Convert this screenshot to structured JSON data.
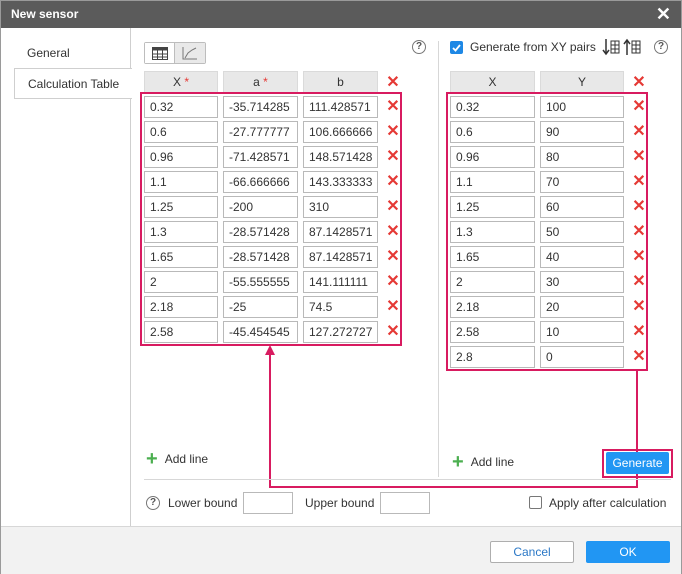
{
  "window": {
    "title": "New sensor"
  },
  "sidebar": {
    "tabs": [
      {
        "label": "General"
      },
      {
        "label": "Calculation Table"
      }
    ]
  },
  "left_table": {
    "headers": [
      "X",
      "a",
      "b"
    ],
    "rows": [
      [
        "0.32",
        "-35.714285",
        "111.428571"
      ],
      [
        "0.6",
        "-27.777777",
        "106.666666"
      ],
      [
        "0.96",
        "-71.428571",
        "148.571428"
      ],
      [
        "1.1",
        "-66.666666",
        "143.333333"
      ],
      [
        "1.25",
        "-200",
        "310"
      ],
      [
        "1.3",
        "-28.571428",
        "87.1428571"
      ],
      [
        "1.65",
        "-28.571428",
        "87.1428571"
      ],
      [
        "2",
        "-55.555555",
        "141.111111"
      ],
      [
        "2.18",
        "-25",
        "74.5"
      ],
      [
        "2.58",
        "-45.454545",
        "127.272727"
      ]
    ],
    "add_line_label": "Add line"
  },
  "right_table": {
    "generate_checkbox_label": "Generate from XY pairs",
    "generate_checked": true,
    "headers": [
      "X",
      "Y"
    ],
    "rows": [
      [
        "0.32",
        "100"
      ],
      [
        "0.6",
        "90"
      ],
      [
        "0.96",
        "80"
      ],
      [
        "1.1",
        "70"
      ],
      [
        "1.25",
        "60"
      ],
      [
        "1.3",
        "50"
      ],
      [
        "1.65",
        "40"
      ],
      [
        "2",
        "30"
      ],
      [
        "2.18",
        "20"
      ],
      [
        "2.58",
        "10"
      ],
      [
        "2.8",
        "0"
      ]
    ],
    "add_line_label": "Add line",
    "generate_button_label": "Generate"
  },
  "bounds": {
    "lower_label": "Lower bound",
    "lower_value": "",
    "upper_label": "Upper bound",
    "upper_value": "",
    "apply_label": "Apply after calculation",
    "apply_checked": false
  },
  "footer": {
    "cancel_label": "Cancel",
    "ok_label": "OK"
  },
  "colors": {
    "accent": "#2196f3",
    "delete": "#e53935",
    "highlight": "#d81b60",
    "add": "#4caf50",
    "titlebar": "#5b5b5b"
  }
}
